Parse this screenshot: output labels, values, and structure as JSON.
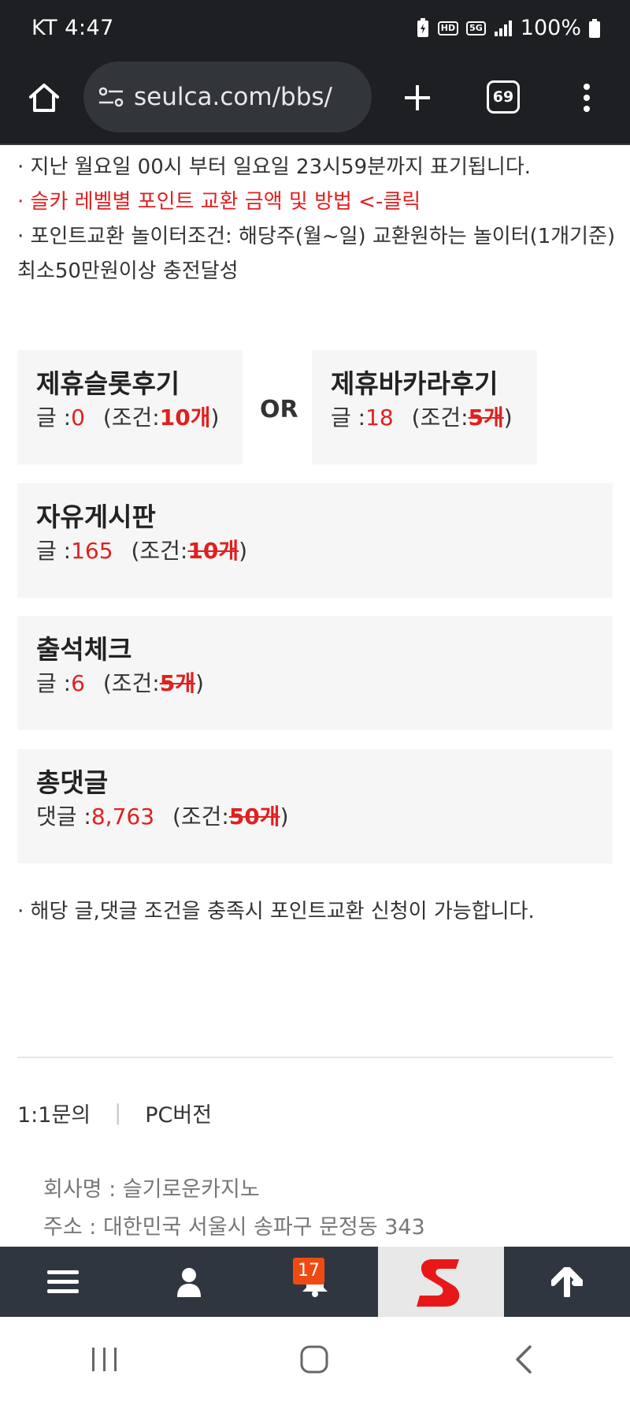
{
  "status_bar": {
    "carrier_time": "KT 4:47",
    "hd_label": "HD",
    "net_label": "5G",
    "battery": "100%"
  },
  "browser": {
    "url": "seulca.com/bbs/",
    "tab_count": "69"
  },
  "notes": {
    "line1": "· 지난 월요일 00시 부터 일요일 23시59분까지 표기됩니다.",
    "line2": "· 슬카 레벨별 포인트 교환 금액 및 방법 <-클릭",
    "line3": "· 포인트교환 놀이터조건: 해당주(월~일) 교환원하는 놀이터(1개기준) 최소50만원이상 충전달성"
  },
  "or_label": "OR",
  "cards": {
    "slot": {
      "title": "제휴슬롯후기",
      "count_label": "글 :",
      "count": "0",
      "cond_prefix": "(조건:",
      "cond_value": "10개",
      "cond_suffix": ")"
    },
    "baccarat": {
      "title": "제휴바카라후기",
      "count_label": "글 :",
      "count": "18",
      "cond_prefix": "(조건:",
      "cond_value": "5개",
      "cond_suffix": ")"
    },
    "free": {
      "title": "자유게시판",
      "count_label": "글 :",
      "count": "165",
      "cond_prefix": "(조건:",
      "cond_value": "10개",
      "cond_suffix": ")"
    },
    "attendance": {
      "title": "출석체크",
      "count_label": "글 :",
      "count": "6",
      "cond_prefix": "(조건:",
      "cond_value": "5개",
      "cond_suffix": ")"
    },
    "comments": {
      "title": "총댓글",
      "count_label": "댓글 :",
      "count": "8,763",
      "cond_prefix": "(조건:",
      "cond_value": "50개",
      "cond_suffix": ")"
    }
  },
  "bottom_note": "· 해당 글,댓글 조건을 충족시 포인트교환 신청이 가능합니다.",
  "footer": {
    "link1": "1:1문의",
    "separator": "|",
    "link2": "PC버전",
    "company": "회사명 : 슬기로운카지노",
    "address": "주소 : 대한민국 서울시 송파구 문정동 343"
  },
  "site_nav": {
    "notification_count": "17"
  },
  "colors": {
    "accent_red": "#e02020",
    "nav_bg": "#2f3640",
    "badge_orange": "#f04a12"
  }
}
